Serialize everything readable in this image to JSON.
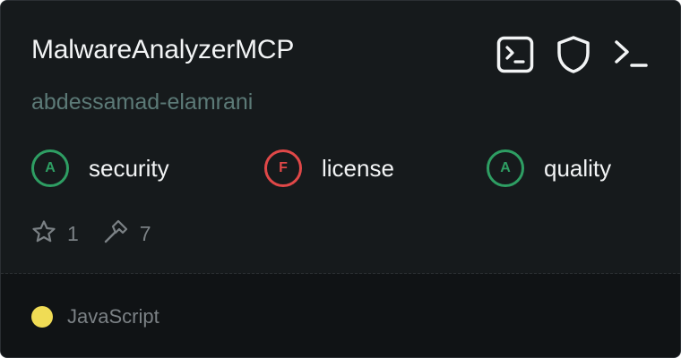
{
  "server": {
    "name": "MalwareAnalyzerMCP",
    "author": "abdessamad-elamrani"
  },
  "header_icons": [
    "terminal-window-icon",
    "shield-icon",
    "terminal-prompt-icon"
  ],
  "grades": [
    {
      "grade": "A",
      "label": "security",
      "status": "pass"
    },
    {
      "grade": "F",
      "label": "license",
      "status": "fail"
    },
    {
      "grade": "A",
      "label": "quality",
      "status": "pass"
    }
  ],
  "stats": {
    "stars": "1",
    "tools": "7"
  },
  "language": {
    "name": "JavaScript",
    "color": "#f0dc55"
  },
  "colors": {
    "pass": "#2e9e63",
    "fail": "#e04848",
    "background": "#161a1c"
  }
}
